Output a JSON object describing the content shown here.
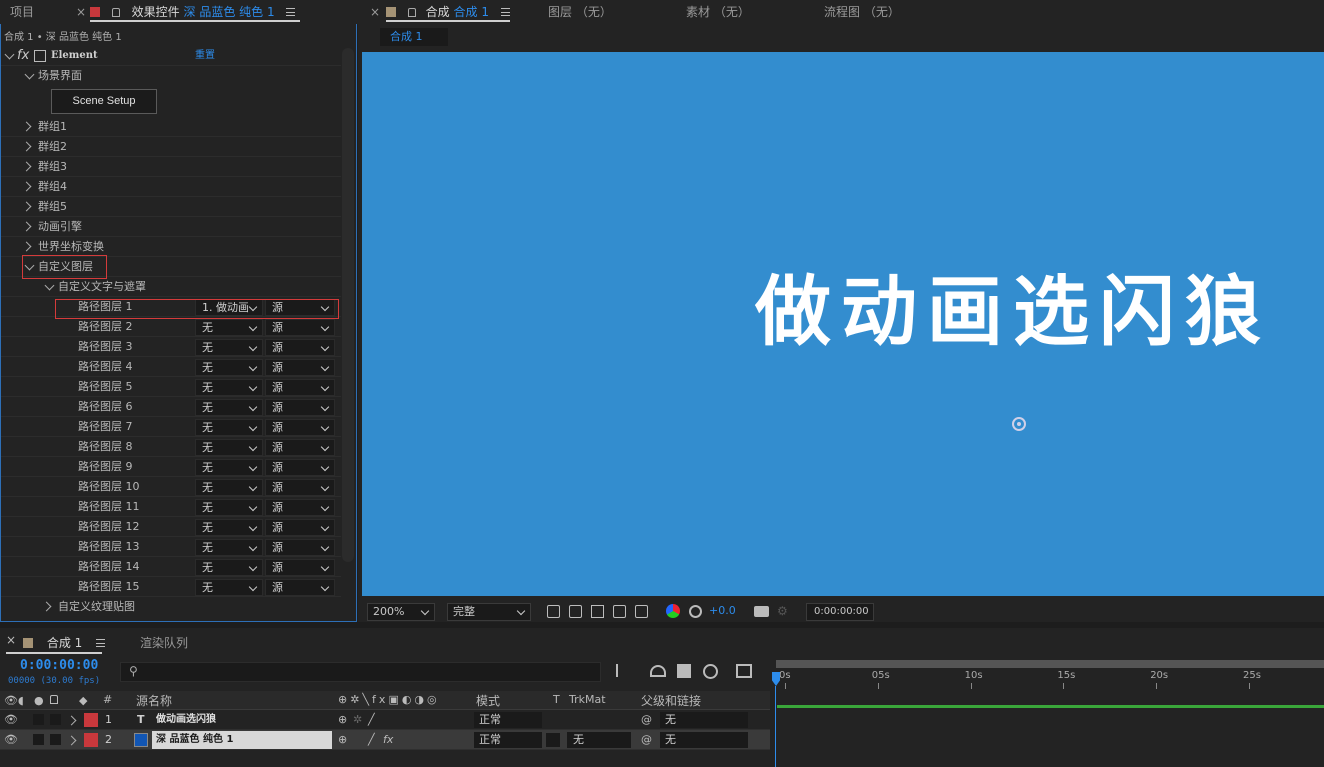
{
  "top_tabs": {
    "project": "项目",
    "effect_controls_label": "效果控件",
    "effect_controls_layer": "深 品蓝色 纯色 1",
    "comp_label": "合成",
    "comp_name": "合成 1",
    "layer_tab": "图层 （无）",
    "footage_tab": "素材 （无）",
    "flowchart_tab": "流程图 （无）"
  },
  "effect_controls": {
    "breadcrumb": "合成 1 • 深 品蓝色 纯色 1",
    "effect_name": "Element",
    "reset": "重置",
    "scene_interface": "场景界面",
    "scene_setup_button": "Scene Setup",
    "groups": [
      "群组1",
      "群组2",
      "群组3",
      "群组4",
      "群组5",
      "动画引擎",
      "世界坐标变换"
    ],
    "custom_layers": "自定义图层",
    "custom_text_mask": "自定义文字与遮罩",
    "path_layers": [
      {
        "label": "路径图层 1",
        "value": "1. 做动画",
        "source": "源"
      },
      {
        "label": "路径图层 2",
        "value": "无",
        "source": "源"
      },
      {
        "label": "路径图层 3",
        "value": "无",
        "source": "源"
      },
      {
        "label": "路径图层 4",
        "value": "无",
        "source": "源"
      },
      {
        "label": "路径图层 5",
        "value": "无",
        "source": "源"
      },
      {
        "label": "路径图层 6",
        "value": "无",
        "source": "源"
      },
      {
        "label": "路径图层 7",
        "value": "无",
        "source": "源"
      },
      {
        "label": "路径图层 8",
        "value": "无",
        "source": "源"
      },
      {
        "label": "路径图层 9",
        "value": "无",
        "source": "源"
      },
      {
        "label": "路径图层 10",
        "value": "无",
        "source": "源"
      },
      {
        "label": "路径图层 11",
        "value": "无",
        "source": "源"
      },
      {
        "label": "路径图层 12",
        "value": "无",
        "source": "源"
      },
      {
        "label": "路径图层 13",
        "value": "无",
        "source": "源"
      },
      {
        "label": "路径图层 14",
        "value": "无",
        "source": "源"
      },
      {
        "label": "路径图层 15",
        "value": "无",
        "source": "源"
      }
    ],
    "custom_texture_maps": "自定义纹理贴图"
  },
  "viewer": {
    "subtab": "合成 1",
    "canvas_text": "做动画选闪狼",
    "canvas_color": "#338dcf",
    "zoom": "200%",
    "resolution": "完整",
    "exposure": "+0.0",
    "timecode": "0:00:00:00"
  },
  "timeline": {
    "tab": "合成 1",
    "render_queue": "渲染队列",
    "current_time": "0:00:00:00",
    "frame_info": "00000 (30.00 fps)",
    "search_placeholder": "",
    "col_num": "#",
    "col_source_name": "源名称",
    "col_mode": "模式",
    "col_t": "T",
    "col_trkmat": "TrkMat",
    "col_parent": "父级和链接",
    "ruler_ticks": [
      "0s",
      "05s",
      "10s",
      "15s",
      "20s",
      "25s"
    ],
    "layers": [
      {
        "num": "1",
        "type": "T",
        "name": "做动画选闪狼",
        "mode": "正常",
        "trkmat": "",
        "parent": "无",
        "label_color": "#c8383c"
      },
      {
        "num": "2",
        "type": "",
        "name": "深 品蓝色 纯色 1",
        "mode": "正常",
        "trkmat": "无",
        "parent": "无",
        "label_color": "#c8383c",
        "swatch_color": "#1256b4"
      }
    ]
  }
}
